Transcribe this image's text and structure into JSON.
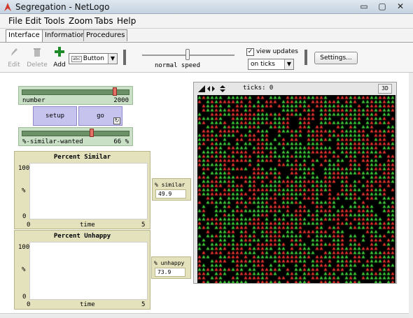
{
  "window": {
    "title": "Segregation - NetLogo"
  },
  "menu": [
    "File",
    "Edit",
    "Tools",
    "Zoom",
    "Tabs",
    "Help"
  ],
  "tabs": [
    "Interface",
    "Information",
    "Procedures"
  ],
  "toolbar": {
    "edit": "Edit",
    "delete": "Delete",
    "add": "Add",
    "widget_type": "Button",
    "speed_label": "normal speed",
    "view_updates": "view updates",
    "update_mode": "on ticks",
    "settings": "Settings..."
  },
  "widgets": {
    "number_slider": {
      "name": "number",
      "value": "2000",
      "fraction": 0.88
    },
    "setup_button": "setup",
    "go_button": "go",
    "similar_slider": {
      "name": "%-similar-wanted",
      "value": "66 %",
      "fraction": 0.66
    },
    "plot_similar": {
      "title": "Percent Similar",
      "ymax": "100",
      "ymin": "0",
      "ylabel": "%",
      "xmin": "0",
      "xmax": "5",
      "xlabel": "time"
    },
    "plot_unhappy": {
      "title": "Percent Unhappy",
      "ymax": "100",
      "ymin": "0",
      "ylabel": "%",
      "xmin": "0",
      "xmax": "5",
      "xlabel": "time"
    },
    "monitor_similar": {
      "label": "% similar",
      "value": "49.9"
    },
    "monitor_unhappy": {
      "label": "% unhappy",
      "value": "73.9"
    }
  },
  "view": {
    "ticks_text": "ticks: 0",
    "threed": "3D"
  },
  "colors": {
    "red_turtle": "#e8332e",
    "green_turtle": "#3fcf3a",
    "background": "#000000"
  }
}
